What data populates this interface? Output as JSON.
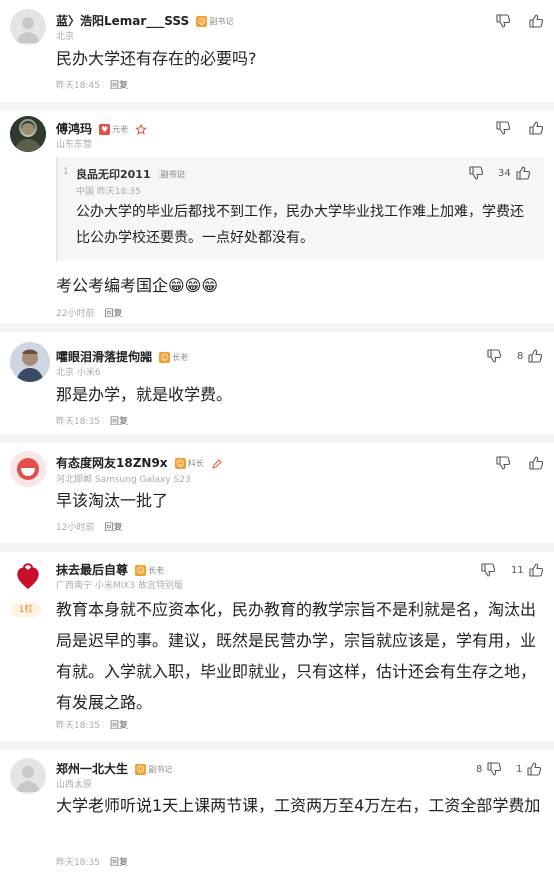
{
  "comments": [
    {
      "user": "蓝〉浩阳Lemar___SSS",
      "badge": "副书记",
      "location": "北京",
      "text": "民办大学还有存在的必要吗?",
      "time": "昨天18:45",
      "reply": "回复",
      "likes": ""
    },
    {
      "user": "傅鸿玛",
      "badge": "元老",
      "location": "山东东营",
      "quote": {
        "floor": "1",
        "user": "良品无印2011",
        "badge": "副书记",
        "location_time": "中国  昨天18:35",
        "likes": "34",
        "text": "公办大学的毕业后都找不到工作，民办大学毕业找工作难上加难，学费还比公办学校还要贵。一点好处都没有。"
      },
      "text": "考公考编考国企😁😁😁",
      "time": "22小时前",
      "reply": "回复",
      "likes": ""
    },
    {
      "user": "嚯眼泪滑落提佝嘂",
      "badge": "长老",
      "location": "北京  小米6",
      "text": "那是办学，就是收学费。",
      "time": "昨天18:35",
      "reply": "回复",
      "likes": "8"
    },
    {
      "user": "有态度网友18ZN9x",
      "badge": "科长",
      "location": "河北邯郸  Samsung Galaxy S23",
      "text": "早该淘汰一批了",
      "time": "12小时前",
      "reply": "回复",
      "likes": ""
    },
    {
      "user": "抹去最后自尊",
      "badge": "长老",
      "location": "广西南宁  小米MIX3 故宫特别版",
      "floor": "1杠",
      "text": "教育本身就不应资本化，民办教育的教学宗旨不是利就是名，淘汰出局是迟早的事。建议，既然是民营办学，宗旨就应该是，学有用，业有就。入学就入职，毕业即就业，只有这样，估计还会有生存之地，有发展之路。",
      "time": "昨天18:35",
      "reply": "回复",
      "likes": "11"
    },
    {
      "user": "郑州一北大生",
      "badge": "副书记",
      "location": "山西太原",
      "text": "大学老师听说1天上课两节课，工资两万至4万左右，工资全部学费加",
      "time": "昨天18:35",
      "reply": "回复",
      "dislikes": "8",
      "likes": "1"
    }
  ],
  "colors": {
    "badge": "#f0a030",
    "badge_red": "#e0504a",
    "separator": "#f4f4f4"
  }
}
